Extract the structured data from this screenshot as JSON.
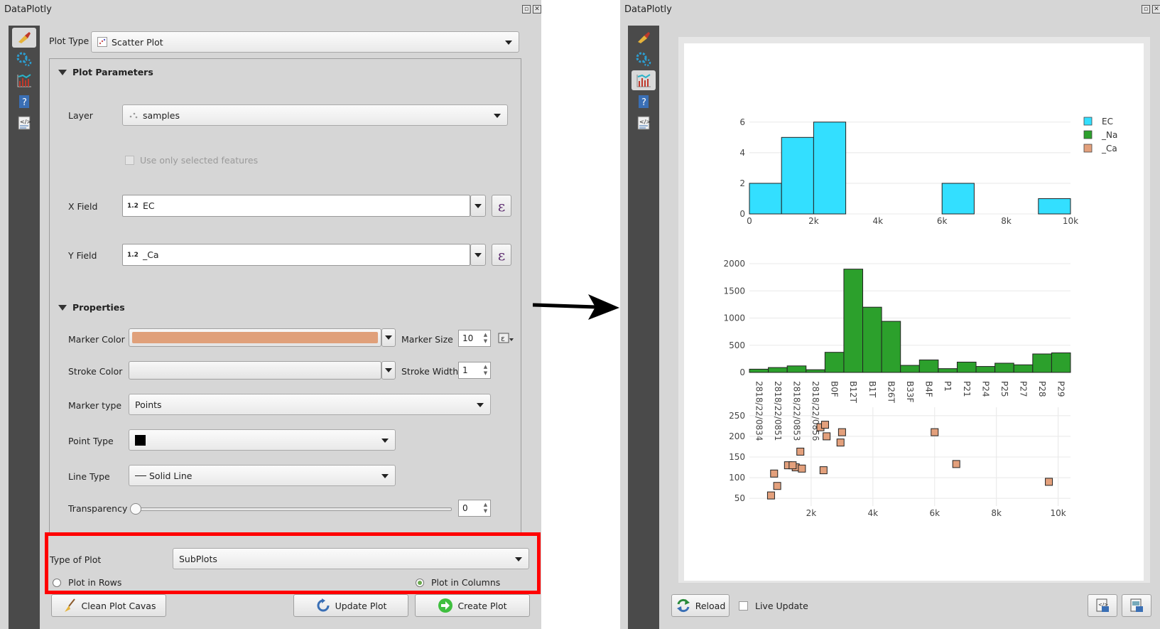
{
  "app": {
    "title": "DataPlotly"
  },
  "left": {
    "plot_type_label": "Plot Type",
    "plot_type_value": "Scatter Plot",
    "plot_params_title": "Plot Parameters",
    "layer_label": "Layer",
    "layer_value": "samples",
    "use_selected_label": "Use only selected features",
    "x_field_label": "X Field",
    "x_field_value": "EC",
    "y_field_label": "Y Field",
    "y_field_value": "_Ca",
    "field_type_tag": "1.2",
    "properties_title": "Properties",
    "marker_color_label": "Marker Color",
    "marker_color": "#e0a07a",
    "marker_size_label": "Marker Size",
    "marker_size_value": "10",
    "stroke_color_label": "Stroke Color",
    "stroke_width_label": "Stroke Width",
    "stroke_width_value": "1",
    "marker_type_label": "Marker type",
    "marker_type_value": "Points",
    "point_type_label": "Point Type",
    "line_type_label": "Line Type",
    "line_type_value": "Solid Line",
    "transparency_label": "Transparency",
    "transparency_value": "0",
    "type_of_plot_label": "Type of Plot",
    "type_of_plot_value": "SubPlots",
    "plot_in_rows_label": "Plot in Rows",
    "plot_in_columns_label": "Plot in Columns",
    "clean_button": "Clean Plot Cavas",
    "update_button": "Update Plot",
    "create_button": "Create Plot"
  },
  "right": {
    "reload_button": "Reload",
    "live_update_label": "Live Update"
  },
  "colors": {
    "ec": "#33dfff",
    "na": "#2ca02c",
    "ca": "#e3a07c",
    "highlight": "#ff0000"
  },
  "chart_data": [
    {
      "type": "bar",
      "title": "",
      "bins": [
        {
          "x0": 0,
          "x1": 1000,
          "y": 2
        },
        {
          "x0": 1000,
          "x1": 2000,
          "y": 5
        },
        {
          "x0": 2000,
          "x1": 3000,
          "y": 6
        },
        {
          "x0": 6000,
          "x1": 7000,
          "y": 2
        },
        {
          "x0": 9000,
          "x1": 10000,
          "y": 1
        }
      ],
      "xlim": [
        0,
        10000
      ],
      "ylim": [
        0,
        6.5
      ],
      "xticks": [
        0,
        2000,
        4000,
        6000,
        8000,
        10000
      ],
      "xtick_labels": [
        "0",
        "2k",
        "4k",
        "6k",
        "8k",
        "10k"
      ],
      "yticks": [
        0,
        2,
        4,
        6
      ],
      "legend": {
        "position": "top-right",
        "entries": [
          "EC",
          "_Na",
          "_Ca"
        ]
      }
    },
    {
      "type": "bar",
      "categories": [
        "2818/22/0834",
        "2818/22/0851",
        "2818/22/0853",
        "2818/22/0856",
        "B0F",
        "B12T",
        "B1T",
        "B26T",
        "B33F",
        "B4F",
        "P1",
        "P21",
        "P24",
        "P25",
        "P27",
        "P28",
        "P29"
      ],
      "tick_categories": [
        "2818/22/0834",
        "2818/22/0851",
        "2818/22/0853",
        "2818/22/0856",
        "B0F",
        "B12T",
        "B1T",
        "B26T",
        "B33F",
        "B4F",
        "P1",
        "P21",
        "P24",
        "P25",
        "P27",
        "P28",
        "P29"
      ],
      "values": [
        60,
        90,
        120,
        50,
        370,
        1900,
        1200,
        940,
        130,
        230,
        70,
        190,
        110,
        170,
        140,
        340,
        360
      ],
      "ylim": [
        0,
        2000
      ],
      "yticks": [
        0,
        500,
        1000,
        1500,
        2000
      ]
    },
    {
      "type": "scatter",
      "x": [
        700,
        900,
        800,
        1500,
        1250,
        1700,
        1650,
        1400,
        2400,
        2300,
        2450,
        2500,
        3000,
        2950,
        6000,
        6700,
        9700
      ],
      "y": [
        57,
        80,
        110,
        125,
        130,
        122,
        163,
        130,
        118,
        222,
        228,
        200,
        210,
        185,
        210,
        133,
        90
      ],
      "xlim": [
        0,
        10400
      ],
      "ylim": [
        40,
        260
      ],
      "xticks": [
        2000,
        4000,
        6000,
        8000,
        10000
      ],
      "xtick_labels": [
        "2k",
        "4k",
        "6k",
        "8k",
        "10k"
      ],
      "yticks": [
        50,
        100,
        150,
        200,
        250
      ]
    }
  ]
}
